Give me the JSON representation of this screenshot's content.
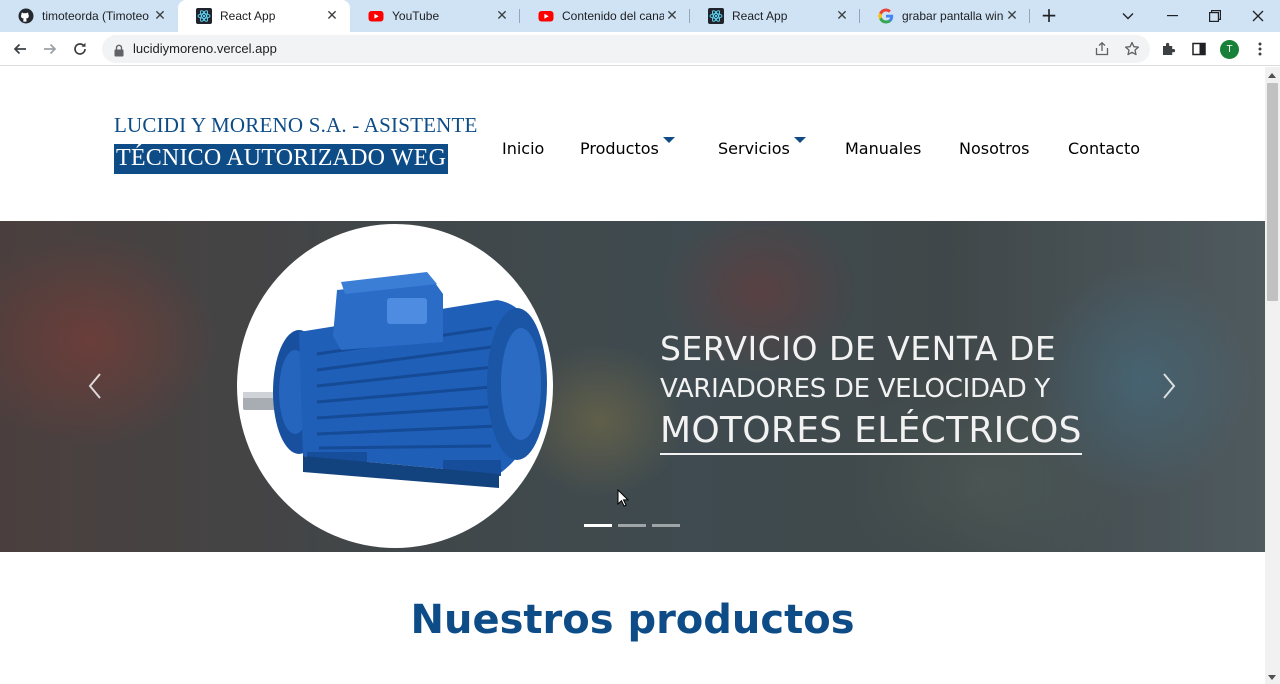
{
  "browser": {
    "tabs": [
      {
        "title": "timoteorda (Timoteo R",
        "favicon": "github-icon"
      },
      {
        "title": "React App",
        "favicon": "react-icon",
        "active": true
      },
      {
        "title": "YouTube",
        "favicon": "youtube-icon"
      },
      {
        "title": "Contenido del canal -",
        "favicon": "youtube-icon"
      },
      {
        "title": "React App",
        "favicon": "react-icon"
      },
      {
        "title": "grabar pantalla windo",
        "favicon": "google-icon"
      }
    ],
    "url": "lucidiymoreno.vercel.app",
    "profile_initial": "T",
    "colors": {
      "tabbar": "#cfe3f5",
      "profile": "#188038"
    }
  },
  "site": {
    "logo_line1": "LUCIDI Y MORENO S.A. - ASISTENTE",
    "logo_line2": "TÉCNICO AUTORIZADO WEG",
    "nav": {
      "inicio": "Inicio",
      "productos": "Productos",
      "servicios": "Servicios",
      "manuales": "Manuales",
      "nosotros": "Nosotros",
      "contacto": "Contacto"
    },
    "carousel": {
      "line1": "SERVICIO DE VENTA DE",
      "line2": "VARIADORES DE VELOCIDAD Y",
      "line3": "MOTORES ELÉCTRICOS",
      "slide_count": 3,
      "active_slide": 1
    },
    "section_title": "Nuestros productos",
    "colors": {
      "brand": "#0d4c87",
      "motor": "#1f5fb8"
    }
  }
}
